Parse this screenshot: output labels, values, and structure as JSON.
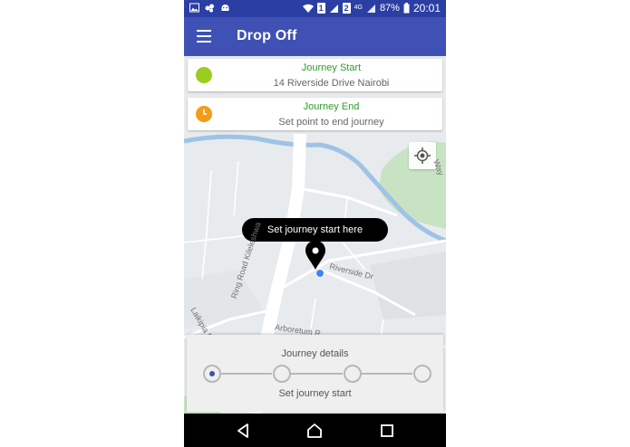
{
  "status_bar": {
    "battery": "87%",
    "time": "20:01",
    "sim1": "1",
    "sim2": "2",
    "network": "4G",
    "icons": [
      "image-icon",
      "bubbles-icon",
      "android-icon",
      "wifi-icon",
      "signal-icon",
      "battery-icon"
    ]
  },
  "app_bar": {
    "title": "Drop Off",
    "menu_icon": "hamburger-menu-icon"
  },
  "journey_start": {
    "title": "Journey Start",
    "address": "14 Riverside Drive Nairobi",
    "color": "#9ccc1d"
  },
  "journey_end": {
    "title": "Journey End",
    "address": "Set point to end journey",
    "color": "#f39c1a"
  },
  "map": {
    "prompt": "Set journey start here",
    "street_labels": {
      "riverside": "Riverside Dr",
      "kileleshwa": "Ring Road Kileleshwa",
      "laikipia": "Laikipia Rd",
      "arboretum": "Arboretum R",
      "way": "Way"
    },
    "my_location_icon": "my-location-icon",
    "pin_icon": "map-pin-icon"
  },
  "journey_details": {
    "title": "Journey details",
    "status": "Set journey start",
    "steps_total": 4,
    "active_step": 1
  },
  "colors": {
    "primary": "#3f51b5",
    "primary_dark": "#2b3ea3",
    "accent_green": "#2e9c2e"
  },
  "nav_bar": {
    "icons": [
      "back-icon",
      "home-icon",
      "recents-icon"
    ]
  }
}
